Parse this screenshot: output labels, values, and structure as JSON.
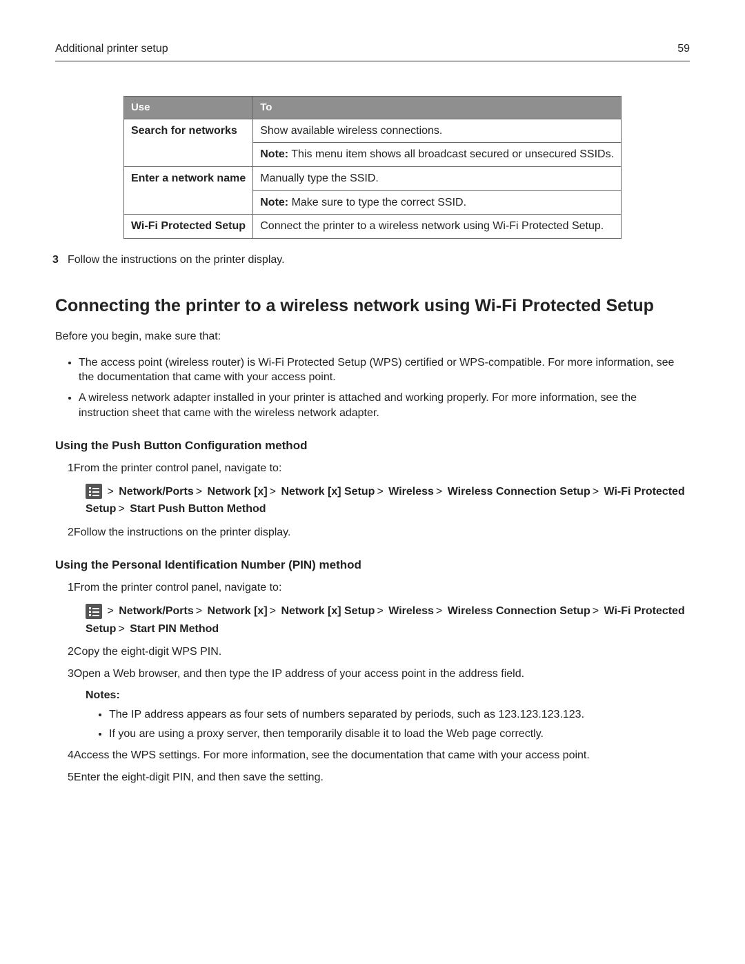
{
  "header": {
    "title": "Additional printer setup",
    "page": "59"
  },
  "table": {
    "h1": "Use",
    "h2": "To",
    "r1c1": "Search for networks",
    "r1c2a": "Show available wireless connections.",
    "r1c2b_label": "Note:",
    "r1c2b": " This menu item shows all broadcast secured or unsecured SSIDs.",
    "r2c1": "Enter a network name",
    "r2c2a": "Manually type the SSID.",
    "r2c2b_label": "Note:",
    "r2c2b": " Make sure to type the correct SSID.",
    "r3c1": "Wi-Fi Protected Setup",
    "r3c2": "Connect the printer to a wireless network using Wi-Fi Protected Setup."
  },
  "step3_num": "3",
  "step3": "Follow the instructions on the printer display.",
  "h2": "Connecting the printer to a wireless network using Wi‑Fi Protected Setup",
  "intro": "Before you begin, make sure that:",
  "intro_b1": "The access point (wireless router) is Wi‑Fi Protected Setup (WPS) certified or WPS‑compatible. For more information, see the documentation that came with your access point.",
  "intro_b2": "A wireless network adapter installed in your printer is attached and working properly. For more information, see the instruction sheet that came with the wireless network adapter.",
  "push": {
    "heading": "Using the Push Button Configuration method",
    "s1n": "1",
    "s1": "From the printer control panel, navigate to:",
    "path": {
      "p1": "Network/Ports",
      "p2": "Network [x]",
      "p3": "Network [x] Setup",
      "p4": "Wireless",
      "p5": "Wireless Connection Setup",
      "p6": "Wi‑Fi Protected Setup",
      "p7": "Start Push Button Method"
    },
    "s2n": "2",
    "s2": "Follow the instructions on the printer display."
  },
  "pin": {
    "heading": "Using the Personal Identification Number (PIN) method",
    "s1n": "1",
    "s1": "From the printer control panel, navigate to:",
    "path": {
      "p1": "Network/Ports",
      "p2": "Network [x]",
      "p3": "Network [x] Setup",
      "p4": "Wireless",
      "p5": "Wireless Connection Setup",
      "p6": "Wi‑Fi Protected Setup",
      "p7": "Start PIN Method"
    },
    "s2n": "2",
    "s2": "Copy the eight‑digit WPS PIN.",
    "s3n": "3",
    "s3": "Open a Web browser, and then type the IP address of your access point in the address field.",
    "notes_label": "Notes:",
    "note1": "The IP address appears as four sets of numbers separated by periods, such as 123.123.123.123.",
    "note2": "If you are using a proxy server, then temporarily disable it to load the Web page correctly.",
    "s4n": "4",
    "s4": "Access the WPS settings. For more information, see the documentation that came with your access point.",
    "s5n": "5",
    "s5": "Enter the eight‑digit PIN, and then save the setting."
  },
  "gt": ">"
}
